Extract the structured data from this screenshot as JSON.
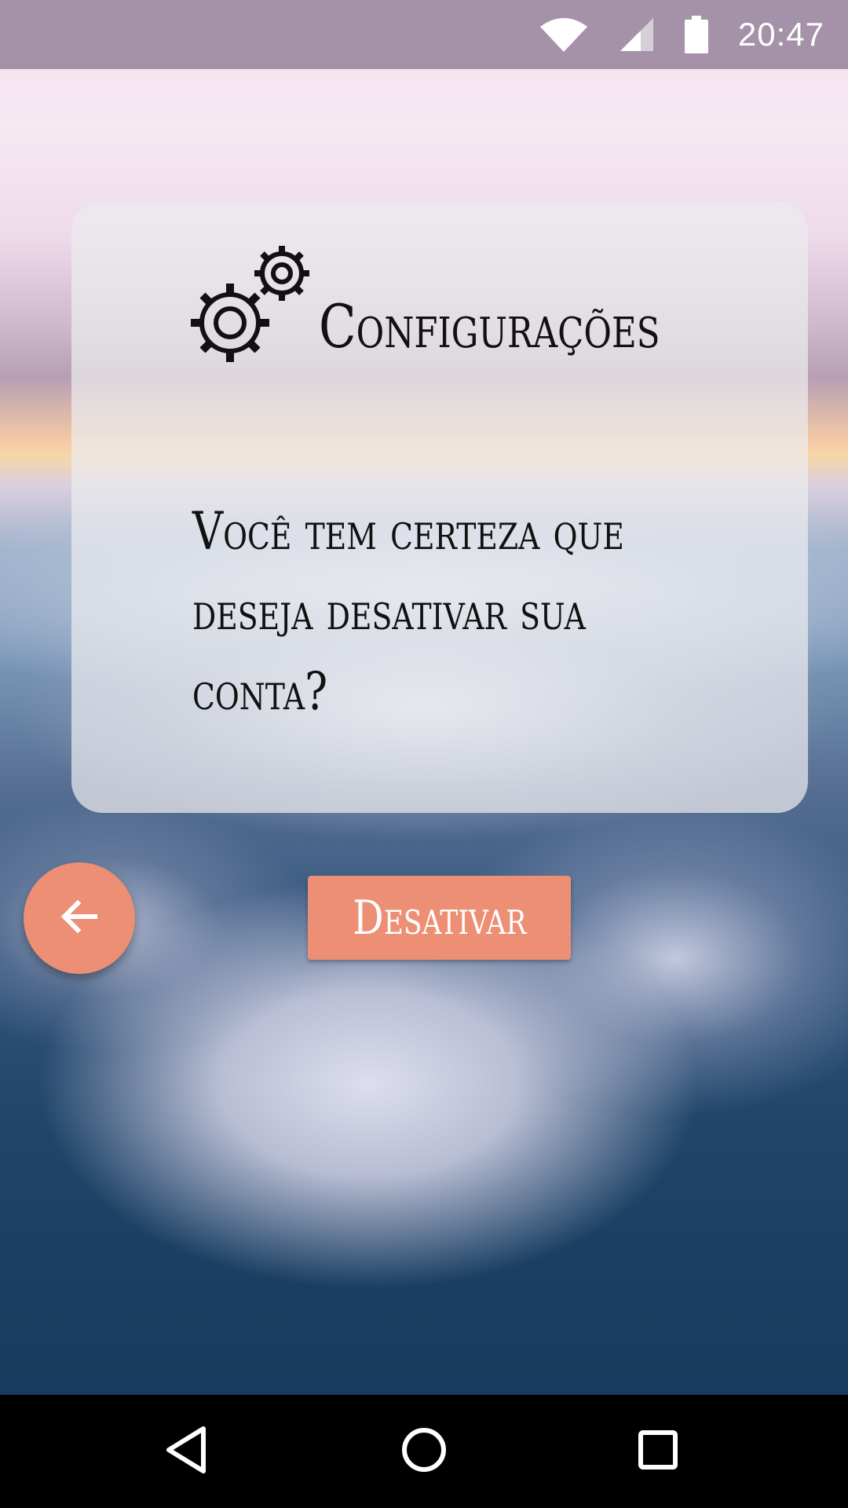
{
  "status_bar": {
    "time": "20:47",
    "icons": [
      "wifi-icon",
      "cellular-signal-icon",
      "battery-icon"
    ]
  },
  "card": {
    "icon": "gears-icon",
    "title": "Configurações",
    "message": "Você tem certeza que deseja desativar sua conta?"
  },
  "actions": {
    "back_icon": "arrow-back-icon",
    "deactivate_label": "Desativar"
  },
  "nav_bar": {
    "icons": [
      "nav-back-icon",
      "nav-home-icon",
      "nav-recents-icon"
    ]
  },
  "colors": {
    "accent": "#ec8f74",
    "status_bar": "#96849b",
    "nav_bar": "#000000",
    "card": "#ebebee"
  }
}
